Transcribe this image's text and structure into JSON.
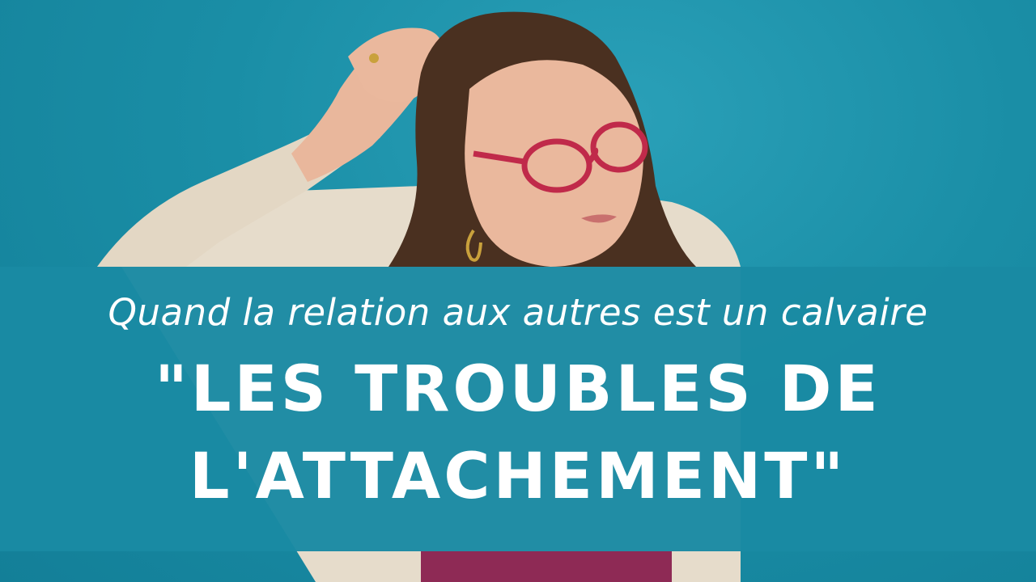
{
  "thumbnail": {
    "subtitle": "Quand la relation aux autres est un calvaire",
    "headline_line1": "\"LES TROUBLES DE",
    "headline_line2": "L'ATTACHEMENT\"",
    "colors": {
      "background": "#1a8ea6",
      "banner": "#1a8aa3",
      "text": "#ffffff",
      "cardigan": "#e6dccb",
      "shirt": "#8e2a55",
      "glasses": "#c02a4a",
      "hair": "#4a3020"
    }
  }
}
